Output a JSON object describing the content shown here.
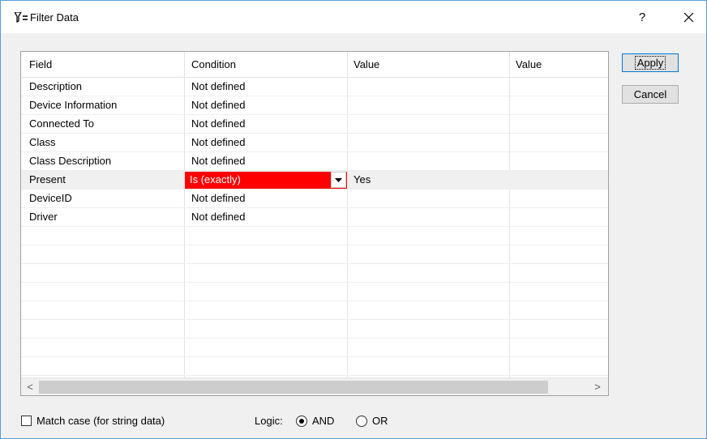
{
  "window": {
    "title": "Filter Data",
    "help_label": "?",
    "title_icon": "filter-icon",
    "close_icon": "close-icon"
  },
  "grid": {
    "columns": [
      "Field",
      "Condition",
      "Value",
      "Value"
    ],
    "rows": [
      {
        "field": "Description",
        "condition": "Not defined",
        "value1": "",
        "value2": ""
      },
      {
        "field": "Device Information",
        "condition": "Not defined",
        "value1": "",
        "value2": ""
      },
      {
        "field": "Connected To",
        "condition": "Not defined",
        "value1": "",
        "value2": ""
      },
      {
        "field": "Class",
        "condition": "Not defined",
        "value1": "",
        "value2": ""
      },
      {
        "field": "Class Description",
        "condition": "Not defined",
        "value1": "",
        "value2": ""
      },
      {
        "field": "Present",
        "condition": "Is (exactly)",
        "value1": "Yes",
        "value2": "",
        "selected": true
      },
      {
        "field": "DeviceID",
        "condition": "Not defined",
        "value1": "",
        "value2": ""
      },
      {
        "field": "Driver",
        "condition": "Not defined",
        "value1": "",
        "value2": ""
      }
    ],
    "empty_rows": 8,
    "scroll_left": "<",
    "scroll_right": ">"
  },
  "buttons": {
    "apply": "Apply",
    "cancel": "Cancel"
  },
  "footer": {
    "match_case_label": "Match case (for string data)",
    "match_case_checked": false,
    "logic_label": "Logic:",
    "logic_options": [
      "AND",
      "OR"
    ],
    "logic_selected": "AND"
  },
  "colors": {
    "highlight": "#ff0000",
    "accent": "#0078d7"
  }
}
